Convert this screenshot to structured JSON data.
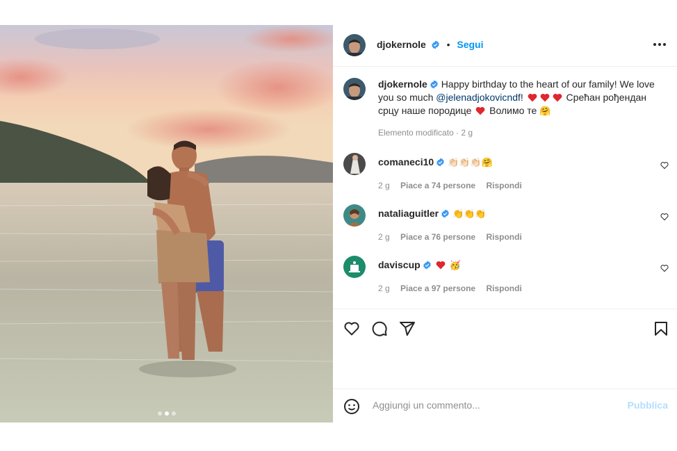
{
  "post": {
    "username": "djokernole",
    "follow_label": "Segui",
    "separator": "•",
    "caption_part1": "Happy birthday to the heart of our family! We love you so much ",
    "caption_mention": "@jelenadjokovicndf",
    "caption_part2": "!",
    "caption_part3": " Срећан рођендан срцу наше породице ",
    "caption_part4": " Волимо те ",
    "caption_emoji_end": "🤗",
    "caption_meta": "Elemento modificato · 2 g",
    "image_dots": 3,
    "active_dot": 1
  },
  "comments": [
    {
      "username": "comaneci10",
      "text": "👏🏻👏🏻👏🏻🤗",
      "age": "2 g",
      "likes": "Piace a 74 persone",
      "reply": "Rispondi"
    },
    {
      "username": "nataliaguitler",
      "text": "👏👏👏",
      "age": "2 g",
      "likes": "Piace a 76 persone",
      "reply": "Rispondi"
    },
    {
      "username": "daviscup",
      "text": "🥳",
      "age": "2 g",
      "likes": "Piace a 97 persone",
      "reply": "Rispondi"
    }
  ],
  "add_comment": {
    "placeholder": "Aggiungi un commento...",
    "publish_label": "Pubblica"
  },
  "colors": {
    "link_blue": "#0095f6",
    "verified_blue": "#3897f0",
    "heart_red": "#ed4956",
    "muted": "#8e8e8e"
  },
  "icons": [
    "verified-badge-icon",
    "more-options-icon",
    "heart-icon",
    "comment-icon",
    "share-icon",
    "bookmark-icon",
    "emoji-icon"
  ]
}
